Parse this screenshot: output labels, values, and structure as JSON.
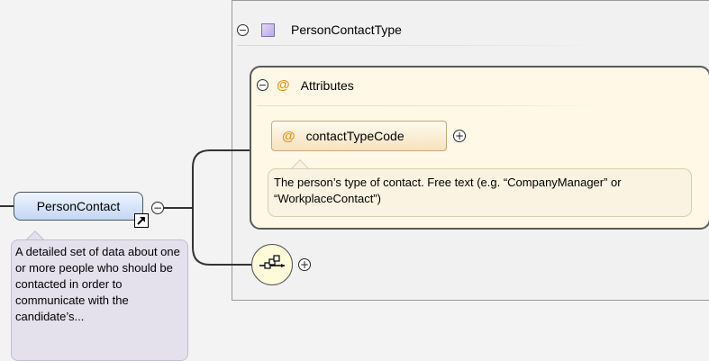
{
  "complex_type": {
    "name": "PersonContactType",
    "icon": "complex-type-icon",
    "collapse_symbol": "−"
  },
  "attributes_group": {
    "title": "Attributes",
    "symbol": "@",
    "collapse_symbol": "−"
  },
  "attribute": {
    "name": "contactTypeCode",
    "symbol": "@",
    "expand_symbol": "+",
    "documentation": "The person’s type of contact. Free text (e.g. “CompanyManager” or “WorkplaceContact”)"
  },
  "root_element": {
    "name": "PersonContact",
    "collapse_symbol": "−",
    "documentation": "A detailed set of data about one or more people who should be contacted in order to communicate with the candidate’s..."
  },
  "sequence": {
    "icon": "sequence-compositor-icon",
    "expand_symbol": "+"
  },
  "colors": {
    "canvas": "#f3f3f3",
    "attribute_fill": "#fff8e6",
    "attribute_symbol": "#e89418",
    "element_fill": "#c3d7f3",
    "type_icon": "#b9a8e2",
    "root_note": "#e4e0ec"
  }
}
